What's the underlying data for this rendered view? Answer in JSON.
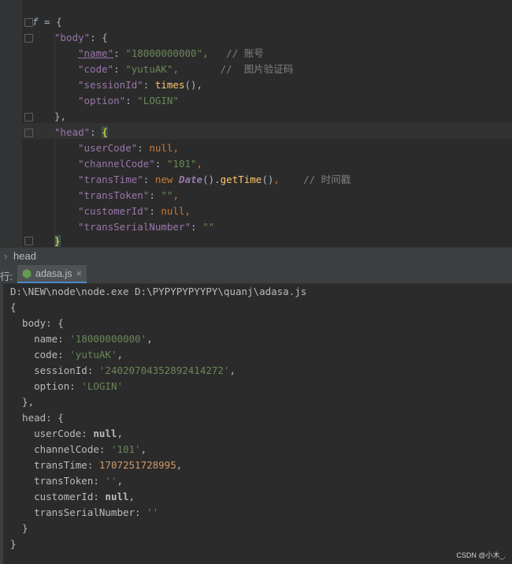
{
  "editor": {
    "lines": [
      {
        "var": "f",
        "rest": " = {"
      },
      {
        "key": "\"body\"",
        "rest": ": {"
      },
      {
        "key": "\"name\"",
        "val": "\"18000000000\"",
        "comment": "// 账号"
      },
      {
        "key": "\"code\"",
        "val": "\"yutuAK\"",
        "comment": "//  图片验证码"
      },
      {
        "key": "\"sessionId\"",
        "fn": "times",
        "rest": "(),"
      },
      {
        "key": "\"option\"",
        "val": "\"LOGIN\""
      },
      {
        "rest": "},"
      },
      {
        "key": "\"head\"",
        "rest": ": {"
      },
      {
        "key": "\"userCode\"",
        "kw": "null"
      },
      {
        "key": "\"channelCode\"",
        "val": "\"101\""
      },
      {
        "key": "\"transTime\"",
        "kw": "new",
        "cls": "Date",
        "fn": "getTime",
        "comment": "// 时间戳"
      },
      {
        "key": "\"transToken\"",
        "val": "\"\""
      },
      {
        "key": "\"customerId\"",
        "kw": "null"
      },
      {
        "key": "\"transSerialNumber\"",
        "val": "\"\""
      },
      {
        "rest": "}"
      }
    ]
  },
  "breadcrumb": {
    "label": "head"
  },
  "run_panel": {
    "side_label": "行:",
    "tab_label": "adasa.js",
    "close_label": "×"
  },
  "console": {
    "command": "D:\\NEW\\node\\node.exe D:\\PYPYPYPYYPY\\quanj\\adasa.js",
    "open": "{",
    "body_open": "  body: {",
    "name_key": "    name: ",
    "name_val": "'18000000000'",
    "code_key": "    code: ",
    "code_val": "'yutuAK'",
    "session_key": "    sessionId: ",
    "session_val": "'24020704352892414272'",
    "option_key": "    option: ",
    "option_val": "'LOGIN'",
    "body_close": "  },",
    "head_open": "  head: {",
    "usercode_key": "    userCode: ",
    "usercode_val": "null",
    "channel_key": "    channelCode: ",
    "channel_val": "'101'",
    "transtime_key": "    transTime: ",
    "transtime_val": "1707251728995",
    "transtoken_key": "    transToken: ",
    "transtoken_val": "''",
    "customer_key": "    customerId: ",
    "customer_val": "null",
    "serial_key": "    transSerialNumber: ",
    "serial_val": "''",
    "head_close": "  }",
    "close": "}"
  },
  "watermark": "CSDN @小木_."
}
